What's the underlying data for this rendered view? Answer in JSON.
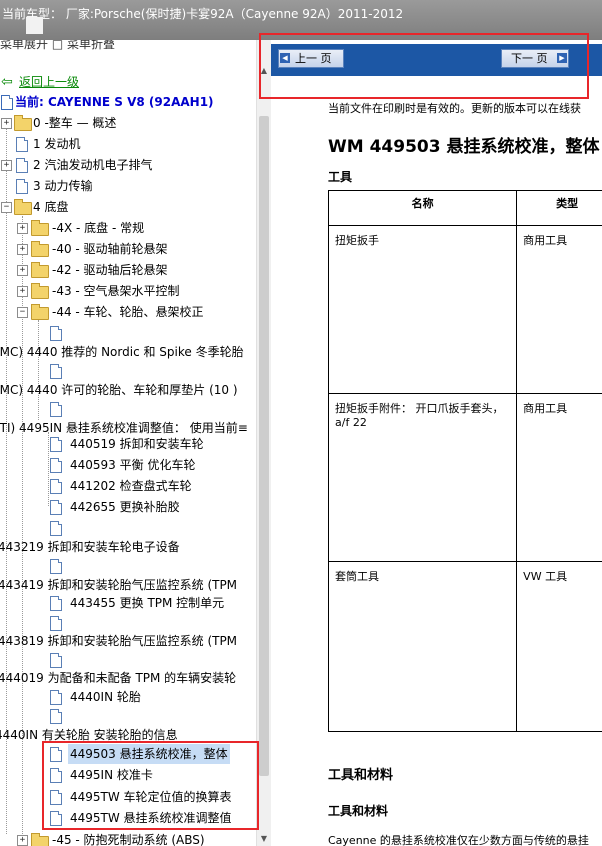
{
  "window": {
    "title": "当前车型：  厂家:Porsche(保时捷)卡宴92A（Cayenne 92A）2011-2012"
  },
  "tree": {
    "toolbar_partial": "菜单展开 □ 菜单折叠",
    "back_link": "返回上一级",
    "current_label": "当前: CAYENNE S V8 (92AAH1)",
    "items": [
      "0 -整车 — 概述",
      "1 发动机",
      "2 汽油发动机电子排气",
      "3 动力传输",
      "4 底盘",
      "-4X - 底盘 - 常规",
      "-40 - 驱动轴前轮悬架",
      "-42 - 驱动轴后轮悬架",
      "-43 - 空气悬架水平控制",
      "-44 - 车轮、轮胎、悬架校正",
      "(MC) 4440 推荐的 Nordic 和 Spike 冬季轮胎",
      "(MC) 4440 许可的轮胎、车轮和厚垫片 (10 )",
      "(TI) 4495IN 悬挂系统校准调整值： 使用当前≡",
      "440519 拆卸和安装车轮",
      "440593 平衡 优化车轮",
      "441202 检查盘式车轮",
      "442655 更换补胎胶",
      "443219 拆卸和安装车轮电子设备",
      "443419 拆卸和安装轮胎气压监控系统 (TPM",
      "443455 更换 TPM 控制单元",
      "443819 拆卸和安装轮胎气压监控系统 (TPM",
      "444019 为配备和未配备 TPM 的车辆安装轮",
      "4440IN 轮胎",
      "4440IN 有关轮胎 安装轮胎的信息",
      "449503 悬挂系统校准，整体",
      "4495IN 校准卡",
      "4495TW 车轮定位值的换算表",
      "4495TW 悬挂系统校准调整值",
      "-45 - 防抱死制动系统 (ABS)"
    ]
  },
  "nav": {
    "prev_label": "上一 页",
    "next_label": "下一 页"
  },
  "doc": {
    "notice": "当前文件在印刷时是有效的。更新的版本可以在线获",
    "title": "WM 449503 悬挂系统校准，整体",
    "tools_heading": "工具",
    "table_headers": [
      "名称",
      "类型"
    ],
    "table_rows": [
      [
        "扭矩扳手",
        "商用工具"
      ],
      [
        "扭矩扳手附件：  开口爪扳手套头，a/f 22",
        "商用工具"
      ],
      [
        "套筒工具",
        "VW 工具"
      ]
    ],
    "tools_materials_heading": "工具和材料",
    "tools_materials_sub": "工具和材料",
    "body_partial": "Cayenne 的悬挂系统校准仅在少数方面与传统的悬挂"
  },
  "colors": {
    "accent_red": "#e8262a",
    "nav_blue": "#1c57a5",
    "title_gray": "#8a8a8a",
    "current_blue": "#0000cc",
    "back_green": "#0a8a0a"
  }
}
